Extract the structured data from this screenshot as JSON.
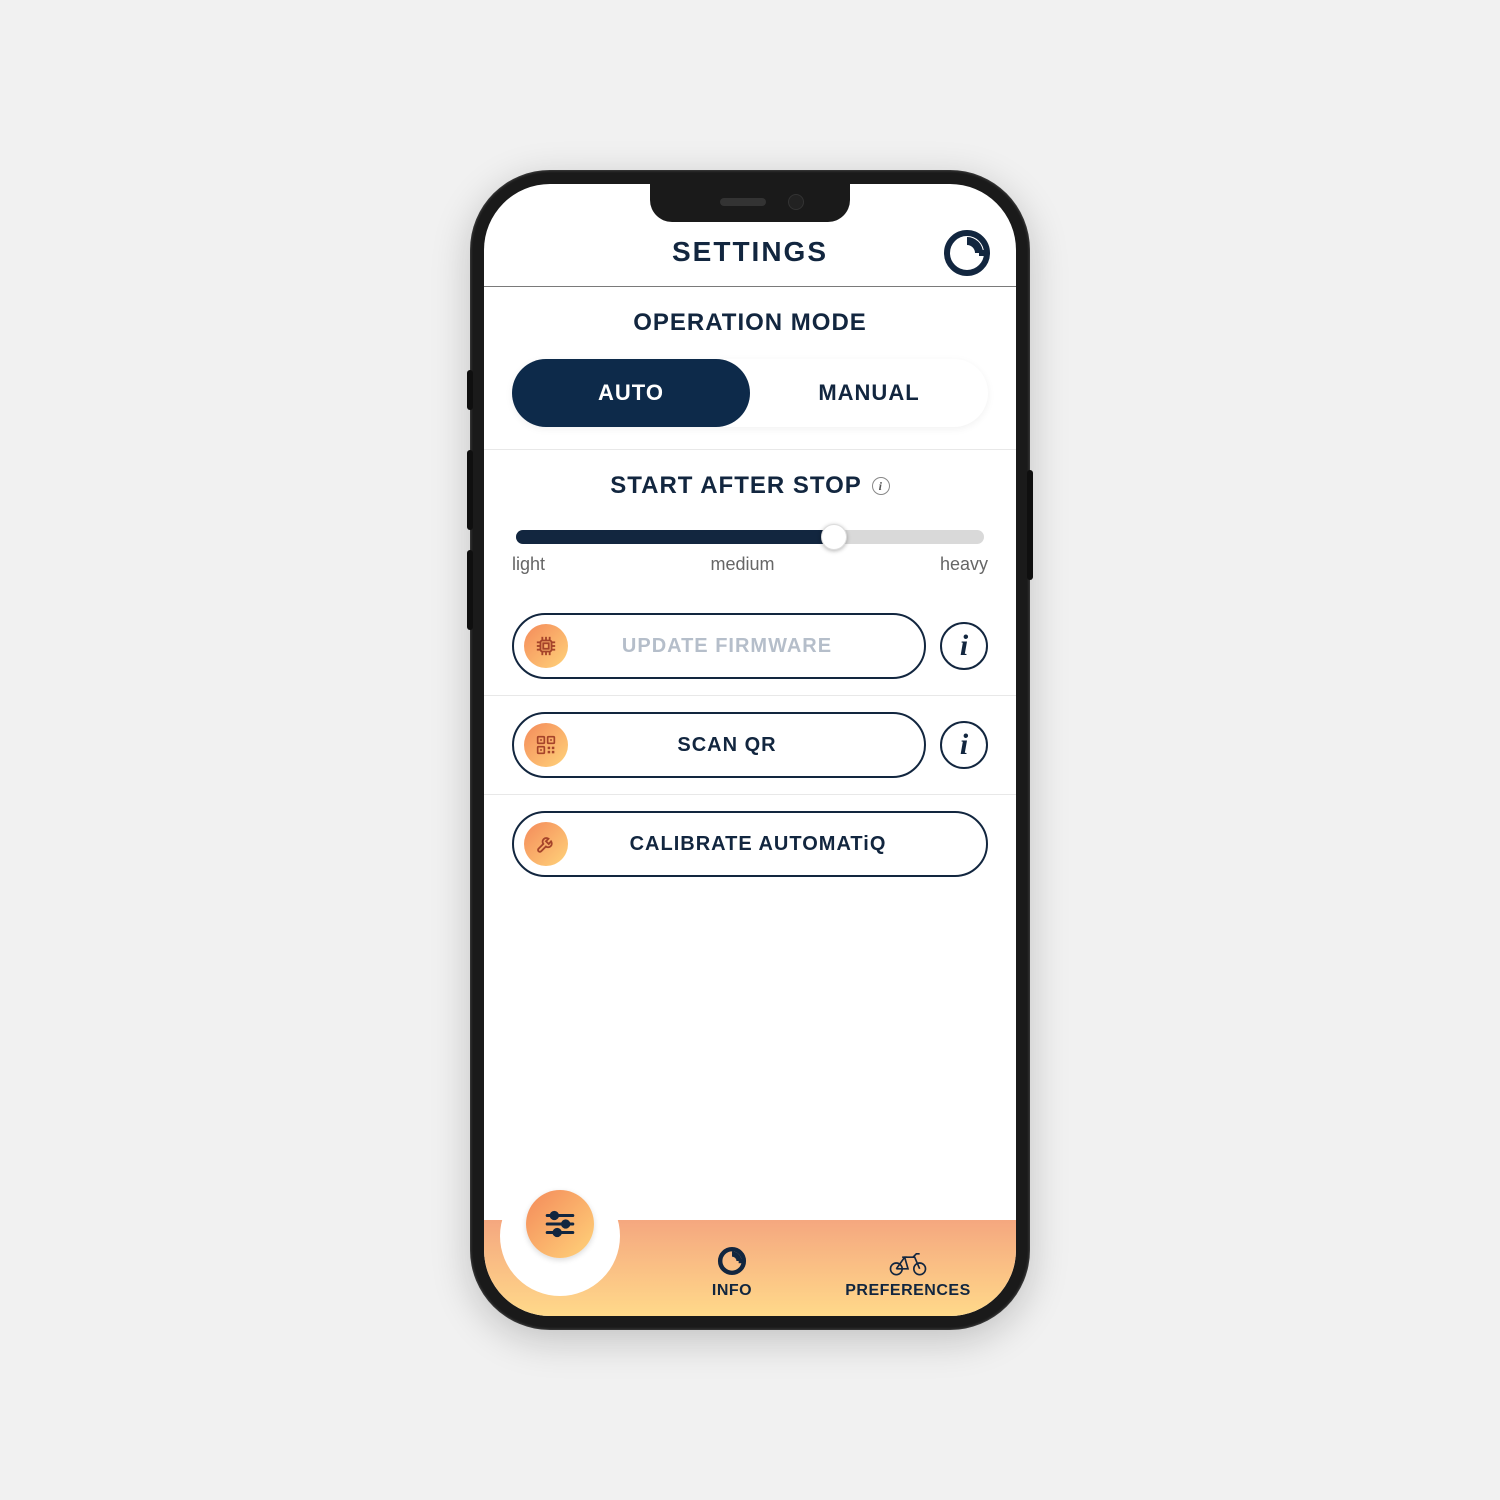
{
  "header": {
    "title": "SETTINGS"
  },
  "operationMode": {
    "title": "OPERATION MODE",
    "options": [
      "AUTO",
      "MANUAL"
    ],
    "active": "AUTO"
  },
  "startAfterStop": {
    "title": "START AFTER STOP",
    "labels": {
      "low": "light",
      "mid": "medium",
      "high": "heavy"
    },
    "valuePercent": 68
  },
  "actions": {
    "updateFirmware": "UPDATE FIRMWARE",
    "scanQr": "SCAN QR",
    "calibrate": "CALIBRATE AUTOMATiQ"
  },
  "nav": {
    "info": "INFO",
    "preferences": "PREFERENCES"
  },
  "colors": {
    "primary": "#12263f",
    "gradientA": "#f48a5a",
    "gradientB": "#ffd37a"
  }
}
